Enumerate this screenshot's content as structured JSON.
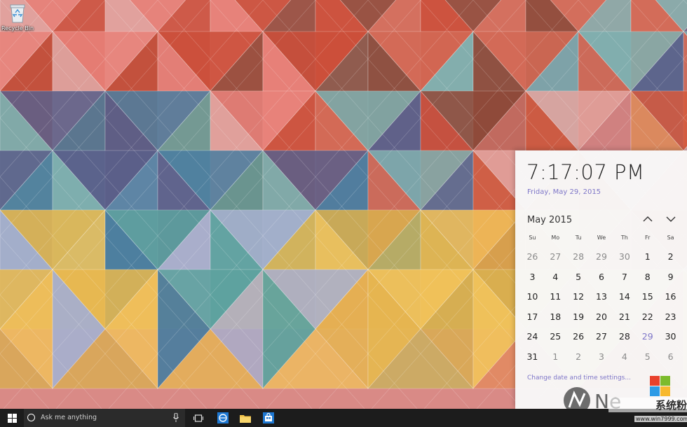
{
  "desktop": {
    "recycle_bin_label": "Recycle Bin"
  },
  "calendar": {
    "time": "7:17:07 PM",
    "date": "Friday, May 29, 2015",
    "month_label": "May 2015",
    "weekdays": [
      "Su",
      "Mo",
      "Tu",
      "We",
      "Th",
      "Fr",
      "Sa"
    ],
    "days": [
      {
        "d": "26",
        "s": "other"
      },
      {
        "d": "27",
        "s": "other"
      },
      {
        "d": "28",
        "s": "other"
      },
      {
        "d": "29",
        "s": "other"
      },
      {
        "d": "30",
        "s": "other"
      },
      {
        "d": "1",
        "s": "cur"
      },
      {
        "d": "2",
        "s": "cur"
      },
      {
        "d": "3",
        "s": "cur"
      },
      {
        "d": "4",
        "s": "cur"
      },
      {
        "d": "5",
        "s": "cur"
      },
      {
        "d": "6",
        "s": "cur"
      },
      {
        "d": "7",
        "s": "cur"
      },
      {
        "d": "8",
        "s": "cur"
      },
      {
        "d": "9",
        "s": "cur"
      },
      {
        "d": "10",
        "s": "cur"
      },
      {
        "d": "11",
        "s": "cur"
      },
      {
        "d": "12",
        "s": "cur"
      },
      {
        "d": "13",
        "s": "cur"
      },
      {
        "d": "14",
        "s": "cur"
      },
      {
        "d": "15",
        "s": "cur"
      },
      {
        "d": "16",
        "s": "cur"
      },
      {
        "d": "17",
        "s": "cur"
      },
      {
        "d": "18",
        "s": "cur"
      },
      {
        "d": "19",
        "s": "cur"
      },
      {
        "d": "20",
        "s": "cur"
      },
      {
        "d": "21",
        "s": "cur"
      },
      {
        "d": "22",
        "s": "cur"
      },
      {
        "d": "23",
        "s": "cur"
      },
      {
        "d": "24",
        "s": "cur"
      },
      {
        "d": "25",
        "s": "cur"
      },
      {
        "d": "26",
        "s": "cur"
      },
      {
        "d": "27",
        "s": "cur"
      },
      {
        "d": "28",
        "s": "cur"
      },
      {
        "d": "29",
        "s": "today"
      },
      {
        "d": "30",
        "s": "cur"
      },
      {
        "d": "31",
        "s": "cur"
      },
      {
        "d": "1",
        "s": "other"
      },
      {
        "d": "2",
        "s": "other"
      },
      {
        "d": "3",
        "s": "other"
      },
      {
        "d": "4",
        "s": "other"
      },
      {
        "d": "5",
        "s": "other"
      },
      {
        "d": "6",
        "s": "other"
      }
    ],
    "settings_link": "Change date and time settings...",
    "accent_color": "#7e76c8",
    "partial_logo_text": "Ne"
  },
  "taskbar": {
    "search_placeholder": "Ask me anything",
    "icons": [
      "windows-start-icon",
      "cortana-circle-icon",
      "microphone-icon",
      "task-view-icon",
      "edge-browser-icon",
      "file-explorer-icon",
      "store-icon"
    ]
  },
  "watermark": {
    "brand_text": "系统粉",
    "url": "www.win7999.com"
  },
  "wallpaper": {
    "palette": [
      "#e2a4a0",
      "#e9827a",
      "#cc4f3a",
      "#8f4a3a",
      "#d36a56",
      "#7fb0b0",
      "#5a5f8a",
      "#4a7da0",
      "#5da3a0",
      "#a7b0cf",
      "#e7b94f",
      "#f2c35a",
      "#d9b04e",
      "#c8b65a",
      "#e58a5a",
      "#d45a3e"
    ]
  }
}
